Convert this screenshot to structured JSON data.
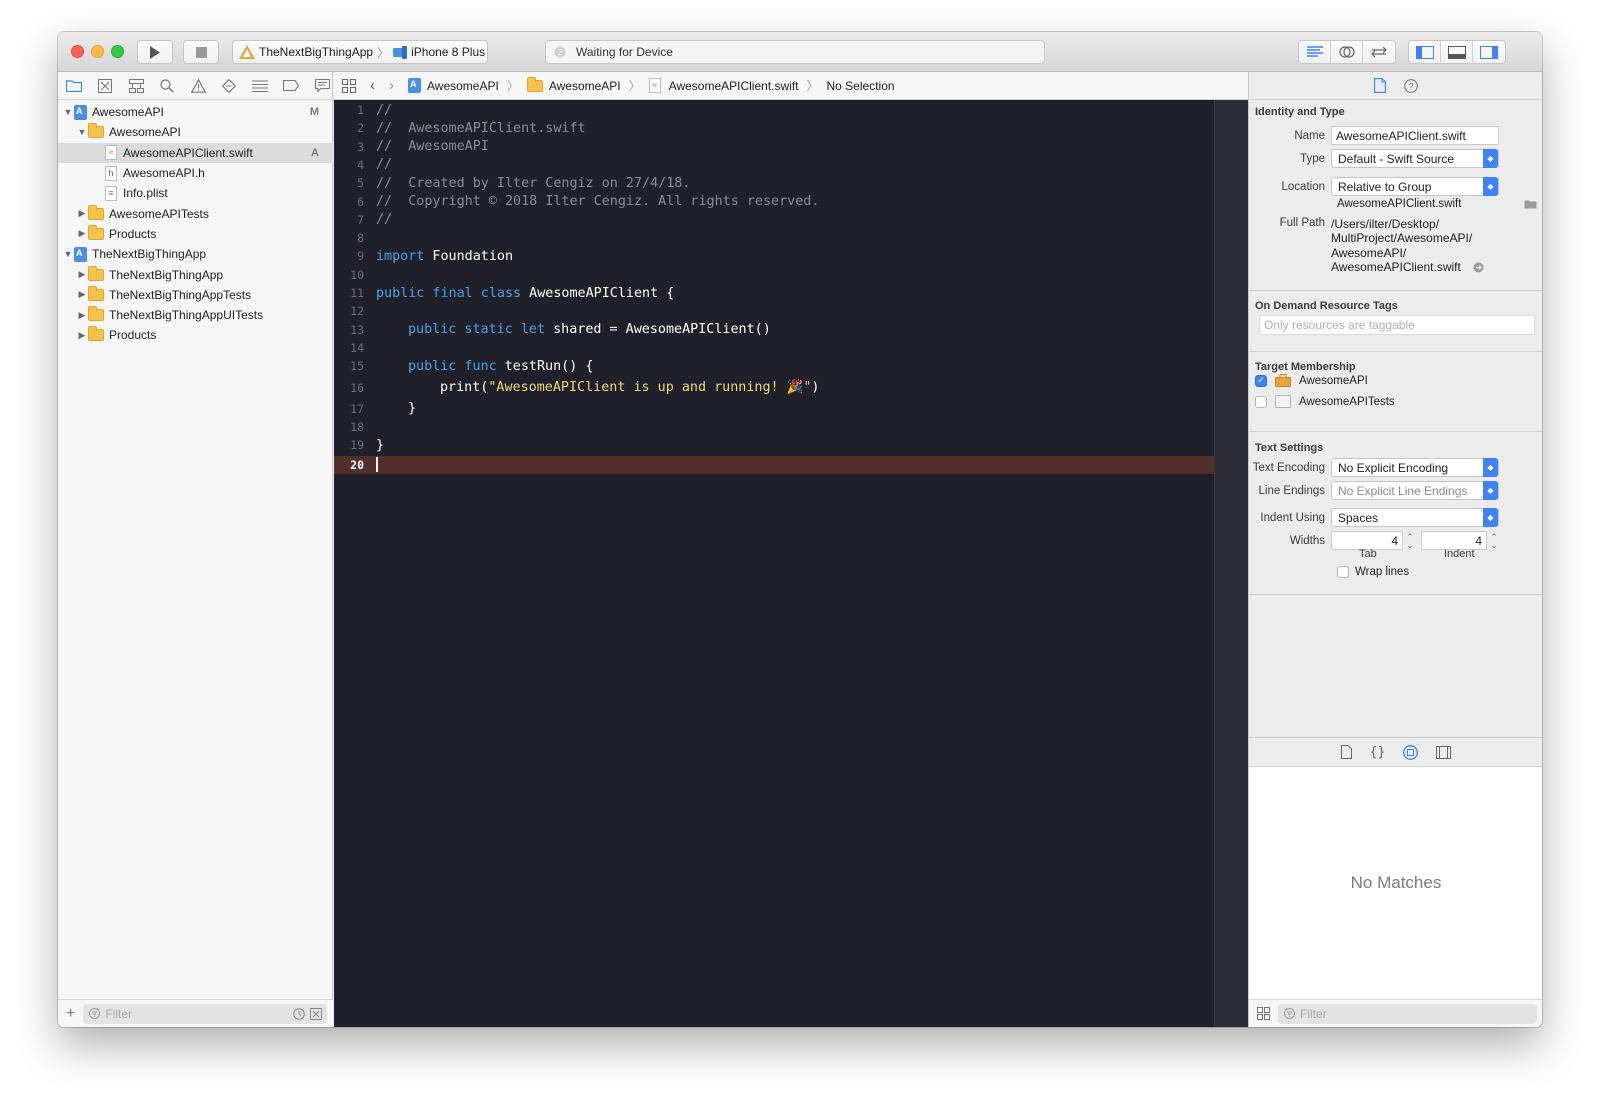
{
  "toolbar": {
    "scheme_target": "TheNextBigThingApp",
    "scheme_device": "iPhone 8 Plus",
    "activity_status": "Waiting for Device"
  },
  "navigator": {
    "items": [
      {
        "label": "AwesomeAPI",
        "badge": "M"
      },
      {
        "label": "AwesomeAPI"
      },
      {
        "label": "AwesomeAPIClient.swift",
        "badge": "A"
      },
      {
        "label": "AwesomeAPI.h"
      },
      {
        "label": "Info.plist"
      },
      {
        "label": "AwesomeAPITests"
      },
      {
        "label": "Products"
      },
      {
        "label": "TheNextBigThingApp"
      },
      {
        "label": "TheNextBigThingApp"
      },
      {
        "label": "TheNextBigThingAppTests"
      },
      {
        "label": "TheNextBigThingAppUITests"
      },
      {
        "label": "Products"
      }
    ],
    "filter_placeholder": "Filter"
  },
  "jumpbar": {
    "crumbs": [
      "AwesomeAPI",
      "AwesomeAPI",
      "AwesomeAPIClient.swift",
      "No Selection"
    ]
  },
  "editor": {
    "line_numbers": [
      "1",
      "2",
      "3",
      "4",
      "5",
      "6",
      "7",
      "8",
      "9",
      "10",
      "11",
      "12",
      "13",
      "14",
      "15",
      "16",
      "17",
      "18",
      "19",
      "20"
    ],
    "current_line": 20,
    "lines": {
      "l1": "//",
      "l2": "//  AwesomeAPIClient.swift",
      "l3": "//  AwesomeAPI",
      "l4": "//",
      "l5": "//  Created by Ilter Cengiz on 27/4/18.",
      "l6": "//  Copyright © 2018 Ilter Cengiz. All rights reserved.",
      "l7": "//",
      "l9_kw": "import",
      "l9_rest": " Foundation",
      "l11_kw": "public final class",
      "l11_rest": " AwesomeAPIClient {",
      "l13_kw": "public static let",
      "l13_rest": " shared = AwesomeAPIClient()",
      "l15_kw": "public func",
      "l15_rest": " testRun() {",
      "l16_a": "print(",
      "l16_str": "\"AwesomeAPIClient is up and running! 🎉\"",
      "l16_b": ")",
      "l17": "}",
      "l19": "}"
    }
  },
  "inspector": {
    "identity_title": "Identity and Type",
    "name_label": "Name",
    "name_value": "AwesomeAPIClient.swift",
    "type_label": "Type",
    "type_value": "Default - Swift Source",
    "location_label": "Location",
    "location_value": "Relative to Group",
    "location_file": "AwesomeAPIClient.swift",
    "fullpath_label": "Full Path",
    "fullpath_lines": [
      "/Users/ilter/Desktop/",
      "MultiProject/AwesomeAPI/",
      "AwesomeAPI/",
      "AwesomeAPIClient.swift"
    ],
    "odr_title": "On Demand Resource Tags",
    "odr_placeholder": "Only resources are taggable",
    "target_title": "Target Membership",
    "targets": [
      {
        "name": "AwesomeAPI",
        "checked": true
      },
      {
        "name": "AwesomeAPITests",
        "checked": false
      }
    ],
    "text_settings_title": "Text Settings",
    "encoding_label": "Text Encoding",
    "encoding_value": "No Explicit Encoding",
    "line_endings_label": "Line Endings",
    "line_endings_value": "No Explicit Line Endings",
    "indent_label": "Indent Using",
    "indent_value": "Spaces",
    "widths_label": "Widths",
    "tab_width": "4",
    "indent_width": "4",
    "tab_caption": "Tab",
    "indent_caption": "Indent",
    "wrap_label": "Wrap lines",
    "library_empty": "No Matches",
    "filter_placeholder": "Filter"
  },
  "colors": {
    "editor_bg": "#1f2029",
    "keyword": "#4ba0ec",
    "comment": "#8a8d96",
    "string": "#f2d97a",
    "current_line": "#532f2b",
    "accent": "#3c83f7"
  }
}
